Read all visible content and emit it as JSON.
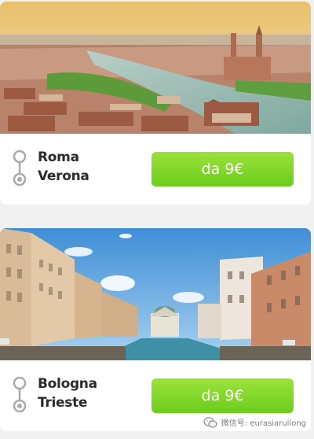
{
  "offers": [
    {
      "image": "verona-cityscape-river",
      "from_city": "Roma",
      "to_city": "Verona",
      "price_label": "da 9€"
    },
    {
      "image": "trieste-canal-grande",
      "from_city": "Bologna",
      "to_city": "Trieste",
      "price_label": "da 9€"
    }
  ],
  "watermark": {
    "text": "微信号: eurasiaruilong",
    "icon": "wechat-icon"
  },
  "colors": {
    "button_top": "#9be23a",
    "button_bottom": "#6ccd1c",
    "route_icon": "#aaaaaa",
    "page_bg": "#f1f1f1"
  }
}
